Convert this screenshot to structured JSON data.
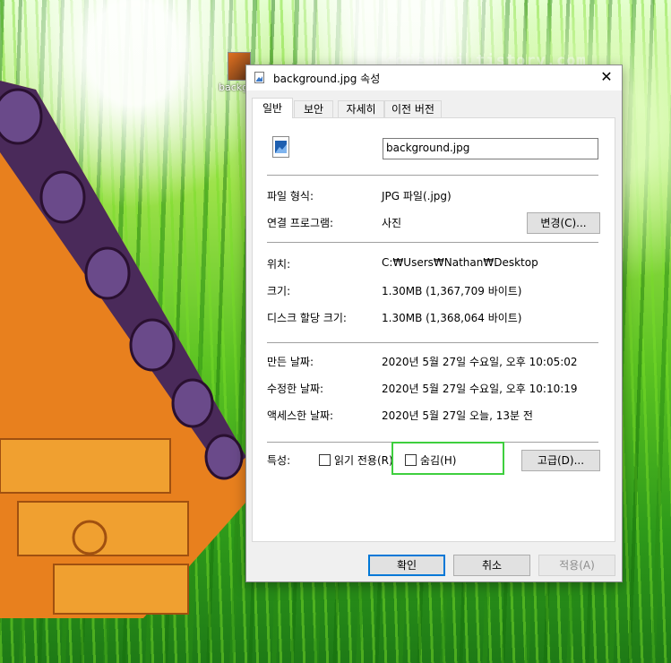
{
  "desktop": {
    "icon_label": "backg",
    "watermark": "codeomni.tistory.com"
  },
  "dialog": {
    "title": "background.jpg 속성",
    "tabs": [
      {
        "label": "일반",
        "active": true
      },
      {
        "label": "보안",
        "active": false
      },
      {
        "label": "자세히",
        "active": false
      },
      {
        "label": "이전 버전",
        "active": false
      }
    ],
    "file_name": "background.jpg",
    "file_type_label": "파일 형식:",
    "file_type_value": "JPG 파일(.jpg)",
    "opens_with_label": "연결 프로그램:",
    "opens_with_value": "사진",
    "change_button": "변경(C)...",
    "location_label": "위치:",
    "location_value": "C:₩Users₩Nathan₩Desktop",
    "size_label": "크기:",
    "size_value": "1.30MB (1,367,709 바이트)",
    "size_on_disk_label": "디스크 할당 크기:",
    "size_on_disk_value": "1.30MB (1,368,064 바이트)",
    "created_label": "만든 날짜:",
    "created_value": "2020년 5월 27일 수요일, 오후 10:05:02",
    "modified_label": "수정한 날짜:",
    "modified_value": "2020년 5월 27일 수요일, 오후 10:10:19",
    "accessed_label": "액세스한 날짜:",
    "accessed_value": "2020년 5월 27일 오늘, 13분 전",
    "attributes_label": "특성:",
    "readonly_label": "읽기 전용(R)",
    "readonly_checked": false,
    "hidden_label": "숨김(H)",
    "hidden_checked": false,
    "advanced_button": "고급(D)...",
    "ok_button": "확인",
    "cancel_button": "취소",
    "apply_button": "적용(A)",
    "highlight_color": "#3ecf3e",
    "accent_color": "#0078d7"
  }
}
